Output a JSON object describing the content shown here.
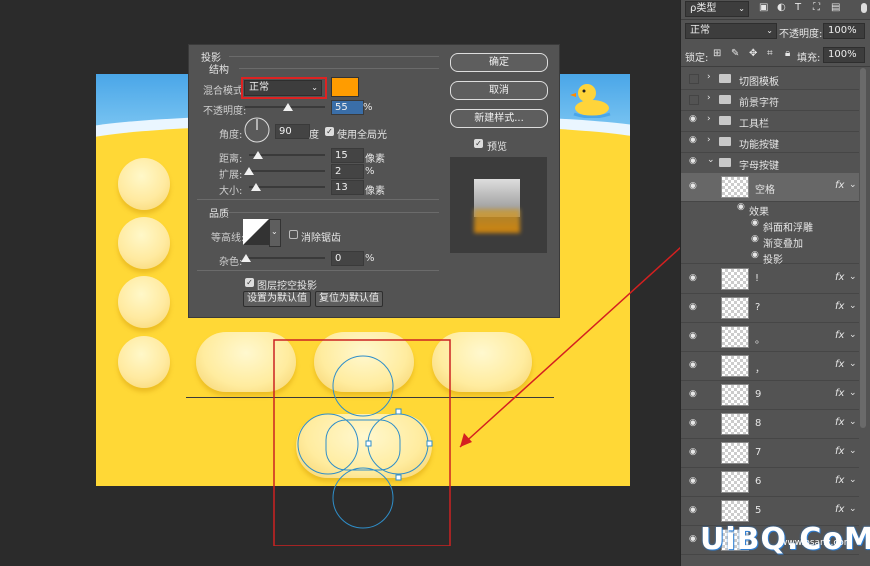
{
  "dialog": {
    "title": "投影",
    "section_structure": "结构",
    "blend_mode_label": "混合模式:",
    "blend_mode_value": "正常",
    "shadow_color": "#ff9c00",
    "opacity_label": "不透明度:",
    "opacity_value": "55",
    "opacity_unit": "%",
    "angle_label": "角度:",
    "angle_value": "90",
    "angle_unit": "度",
    "global_light_label": "使用全局光",
    "distance_label": "距离:",
    "distance_value": "15",
    "distance_unit": "像素",
    "spread_label": "扩展:",
    "spread_value": "2",
    "spread_unit": "%",
    "size_label": "大小:",
    "size_value": "13",
    "size_unit": "像素",
    "section_quality": "品质",
    "contour_label": "等高线:",
    "antialias_label": "消除锯齿",
    "noise_label": "杂色:",
    "noise_value": "0",
    "noise_unit": "%",
    "knockout_label": "图层挖空投影",
    "set_default_label": "设置为默认值",
    "reset_default_label": "复位为默认值",
    "ok_label": "确定",
    "cancel_label": "取消",
    "new_style_label": "新建样式...",
    "preview_label": "预览"
  },
  "panel": {
    "filter_label": "ρ类型",
    "blend_mode": "正常",
    "opacity_label": "不透明度:",
    "opacity_value": "100%",
    "lock_label": "锁定:",
    "fill_label": "填充:",
    "fill_value": "100%",
    "groups": [
      {
        "name": "切图模板"
      },
      {
        "name": "前景字符"
      },
      {
        "name": "工具栏"
      },
      {
        "name": "功能按键"
      },
      {
        "name": "字母按键"
      }
    ],
    "selected_layer": "空格",
    "effects_label": "效果",
    "effects": [
      "斜面和浮雕",
      "渐变叠加",
      "投影"
    ],
    "layers": [
      "!",
      "?",
      "。",
      "，",
      "9",
      "8",
      "7",
      "6",
      "5"
    ]
  },
  "watermark": {
    "text": "UiBQ.CoM",
    "sub": "www.psanz.com"
  }
}
